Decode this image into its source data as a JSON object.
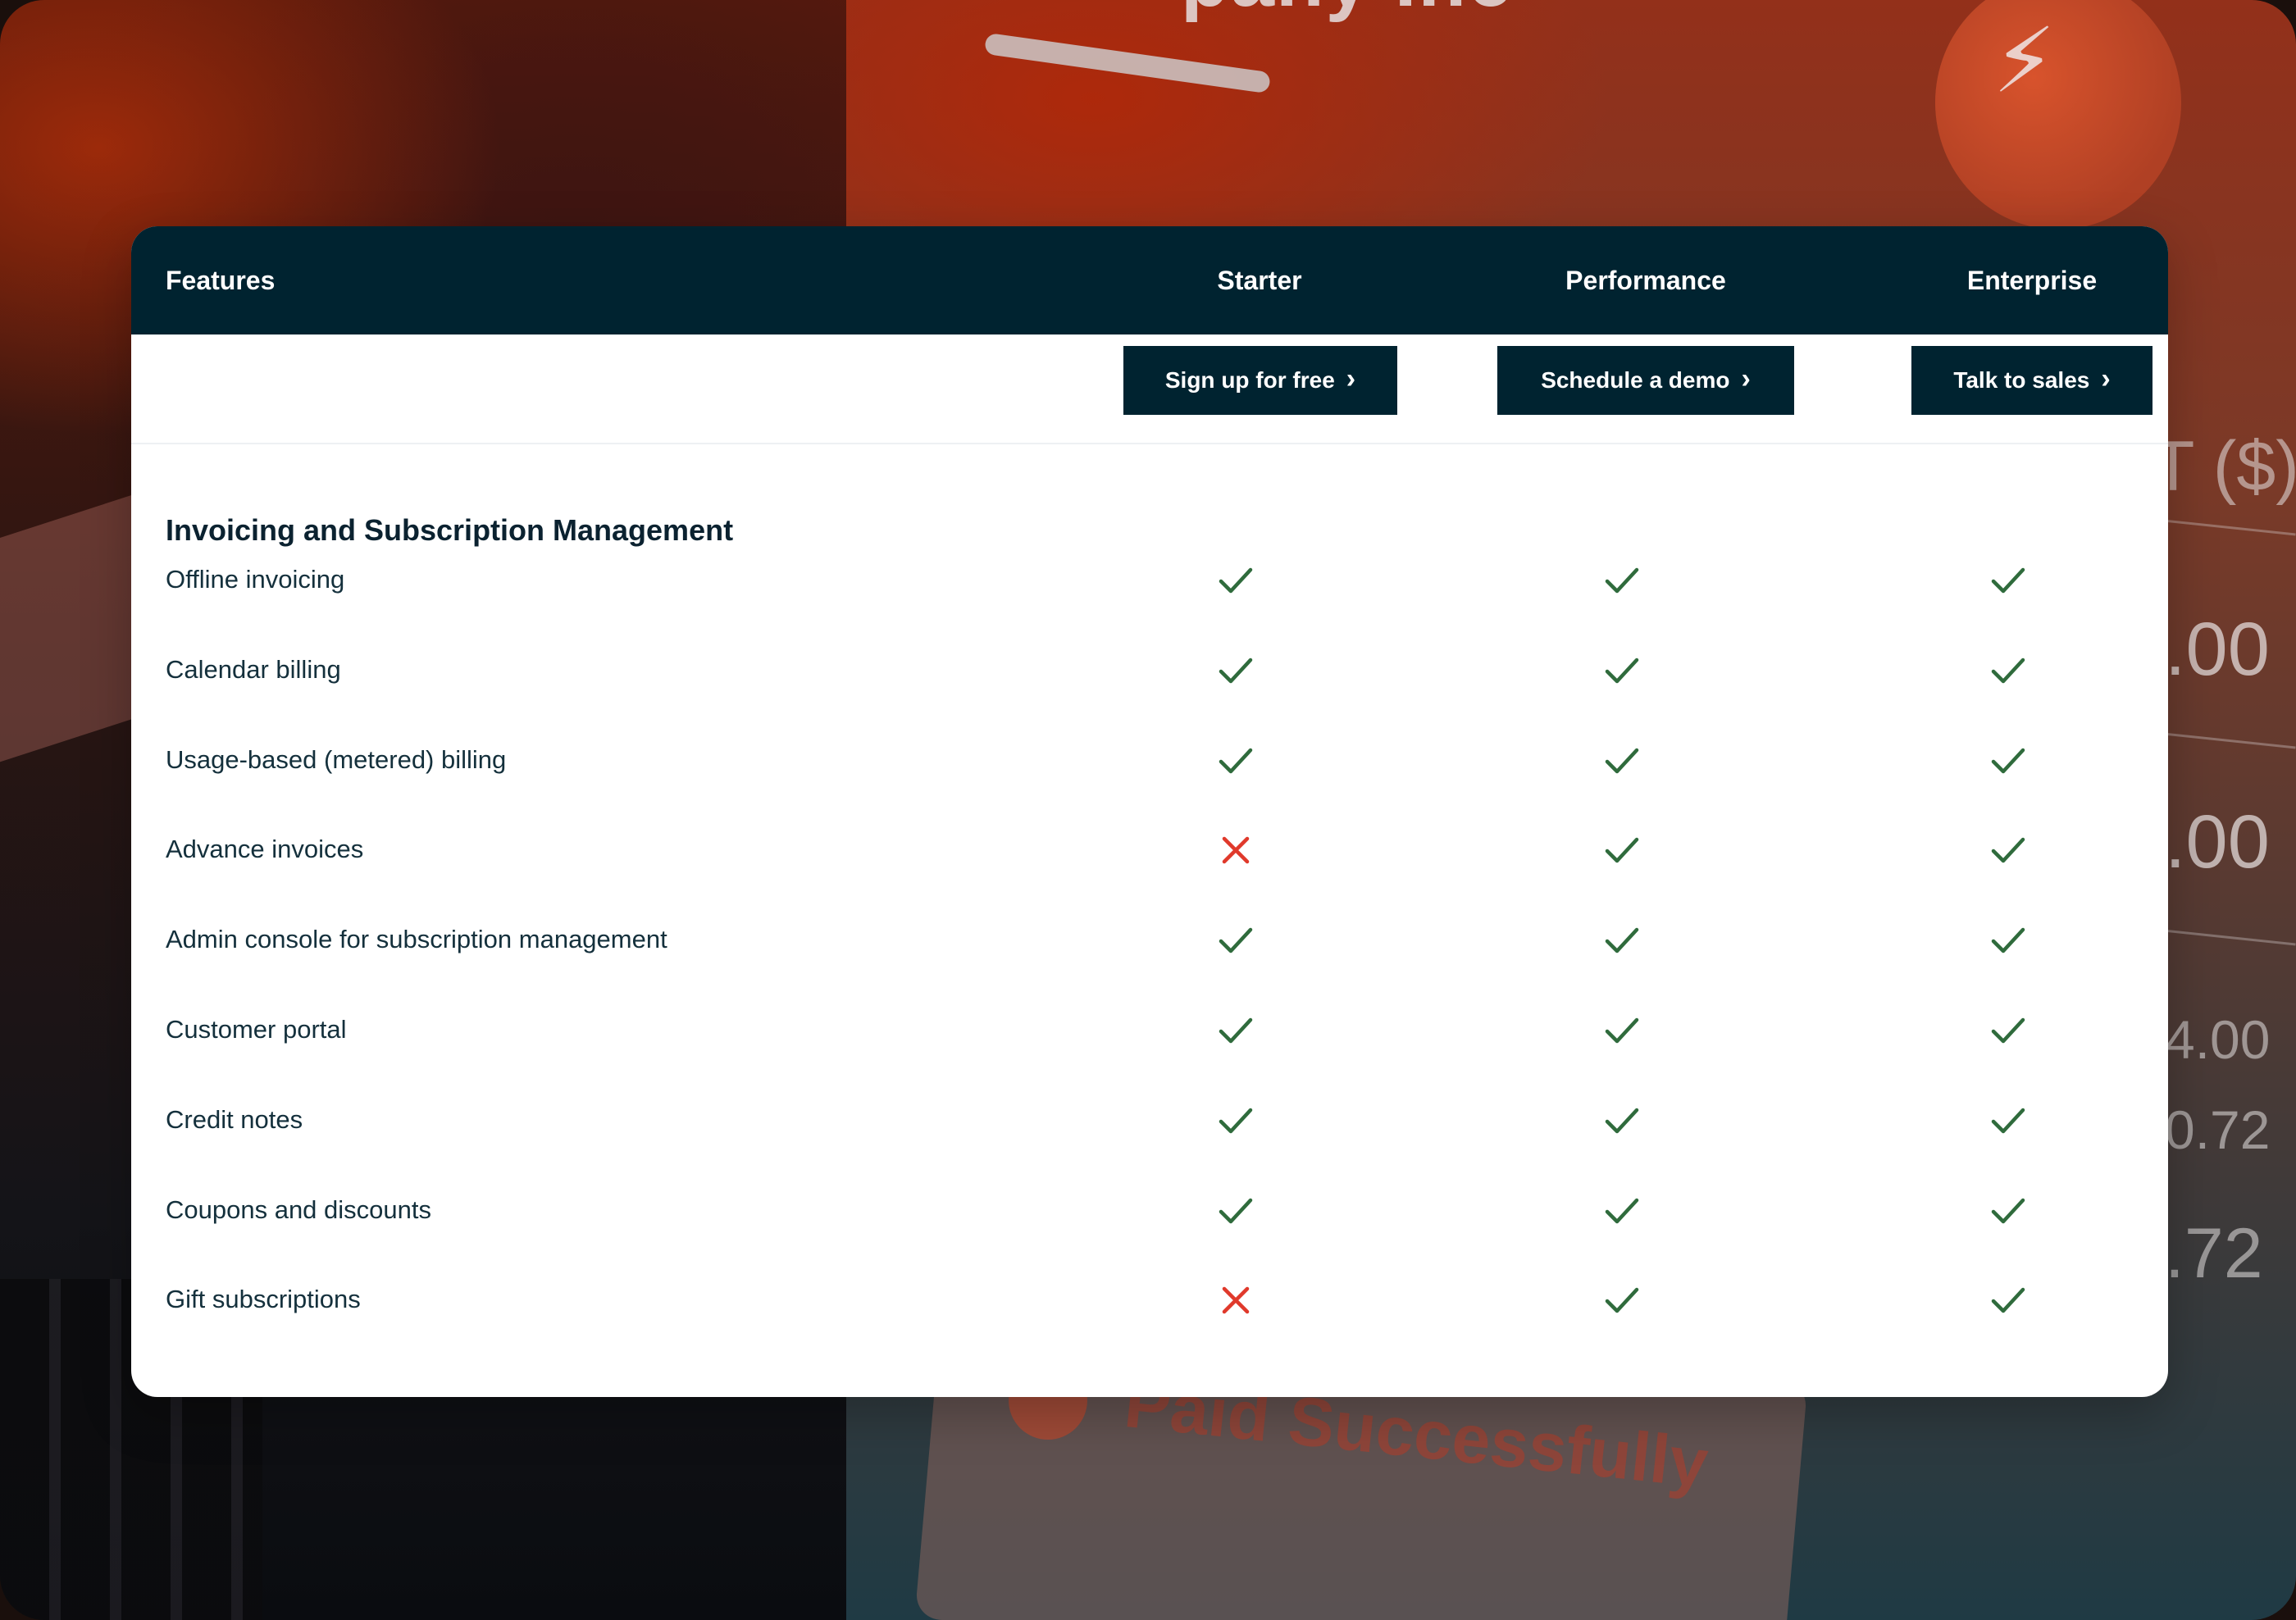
{
  "background": {
    "title_fragment": "pany Inc",
    "amount_header": "IT ($)",
    "amounts": [
      ".00",
      ".00",
      "4.00",
      "0.72",
      ".72"
    ],
    "stamp_text": "Paid Successfully"
  },
  "table": {
    "header": {
      "features": "Features",
      "plans": [
        "Starter",
        "Performance",
        "Enterprise"
      ]
    },
    "cta": {
      "starter": "Sign up for free",
      "performance": "Schedule a demo",
      "enterprise": "Talk to sales"
    },
    "section_title": "Invoicing and Subscription Management",
    "rows": [
      {
        "label": "Offline invoicing",
        "starter": true,
        "performance": true,
        "enterprise": true
      },
      {
        "label": "Calendar billing",
        "starter": true,
        "performance": true,
        "enterprise": true
      },
      {
        "label": "Usage-based (metered) billing",
        "starter": true,
        "performance": true,
        "enterprise": true
      },
      {
        "label": "Advance invoices",
        "starter": false,
        "performance": true,
        "enterprise": true
      },
      {
        "label": "Admin console for subscription management",
        "starter": true,
        "performance": true,
        "enterprise": true
      },
      {
        "label": "Customer portal",
        "starter": true,
        "performance": true,
        "enterprise": true
      },
      {
        "label": "Credit notes",
        "starter": true,
        "performance": true,
        "enterprise": true
      },
      {
        "label": "Coupons and discounts",
        "starter": true,
        "performance": true,
        "enterprise": true
      },
      {
        "label": "Gift subscriptions",
        "starter": false,
        "performance": true,
        "enterprise": true
      }
    ]
  },
  "colors": {
    "header_bg": "#002330",
    "check": "#2f6b3c",
    "cross": "#e0392b"
  },
  "icons": {
    "included": "check-icon",
    "excluded": "cross-icon",
    "button_chevron": "chevron-right-icon"
  }
}
